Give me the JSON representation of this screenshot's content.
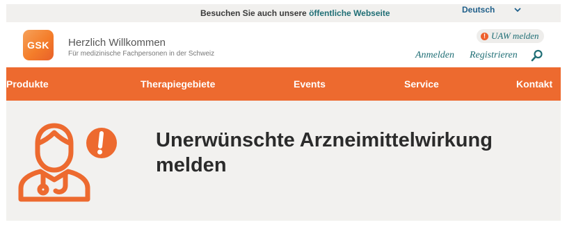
{
  "topbar": {
    "text": "Besuchen Sie auch unsere ",
    "link": "öffentliche Webseite",
    "language": "Deutsch",
    "chevron_icon": "chevron-down-icon"
  },
  "header": {
    "logo_text": "GSK",
    "welcome_title": "Herzlich Willkommen",
    "welcome_subtitle": "Für medizinische Fachpersonen in der Schweiz",
    "uaw_label": "UAW melden",
    "uaw_icon_glyph": "!",
    "login_label": "Anmelden",
    "register_label": "Registrieren",
    "search_icon": "search-icon"
  },
  "nav": {
    "items": [
      "Produkte",
      "Therapiegebiete",
      "Events",
      "Service",
      "Kontakt"
    ]
  },
  "hero": {
    "icon": "person-alert-icon",
    "title": "Unerwünschte Arzneimittelwirkung melden"
  },
  "colors": {
    "brand_orange": "#ed6a2f",
    "link_teal": "#1f6e75",
    "hero_bg": "#f2f1ef"
  }
}
